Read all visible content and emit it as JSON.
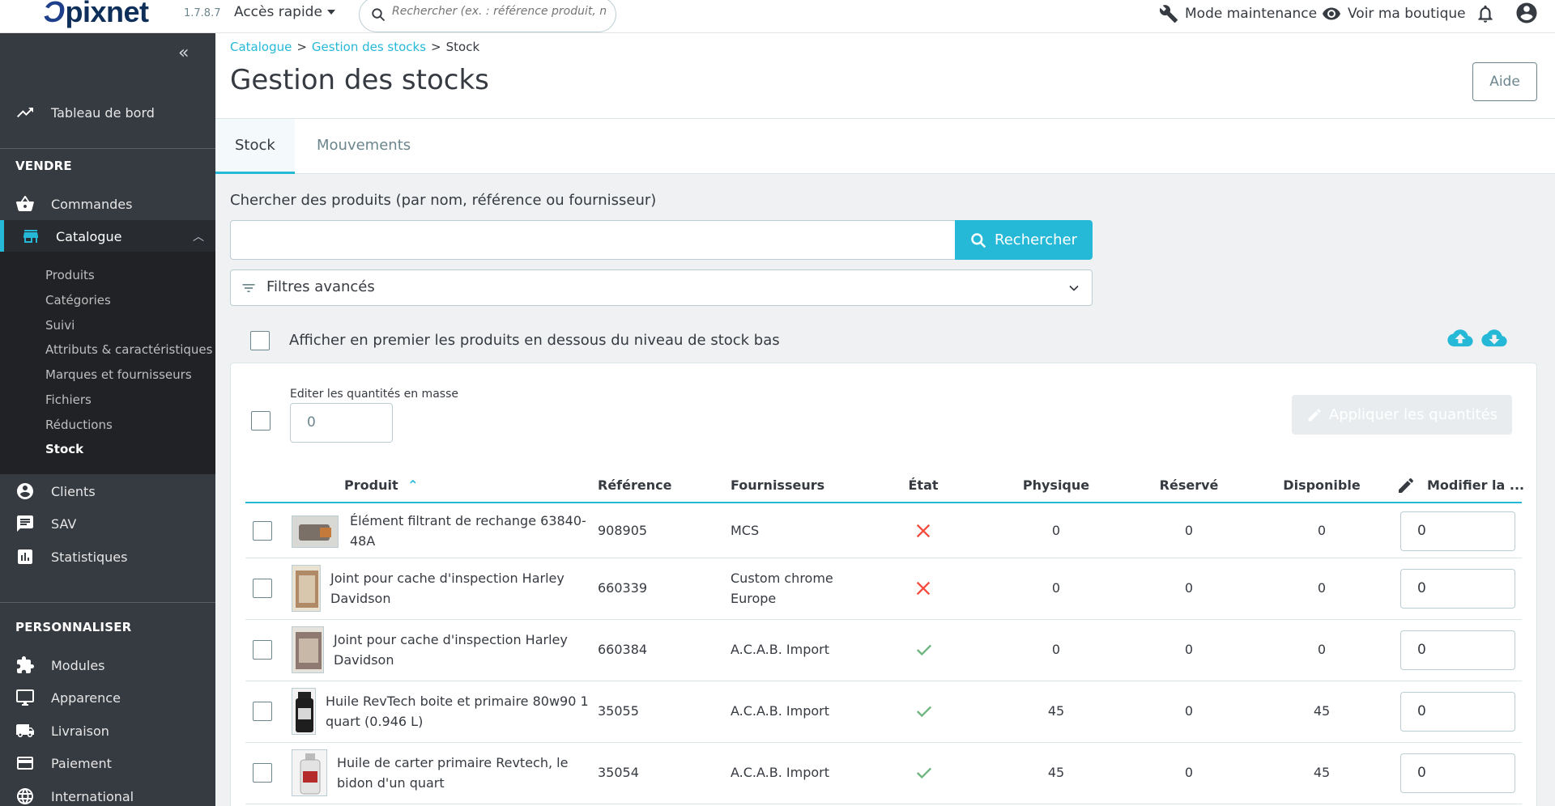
{
  "header": {
    "logo": "pixnet",
    "version": "1.7.8.7",
    "quick_access": "Accès rapide",
    "search_placeholder": "Rechercher (ex. : référence produit, no",
    "maintenance": "Mode maintenance",
    "view_shop": "Voir ma boutique"
  },
  "sidebar": {
    "dashboard": "Tableau de bord",
    "section_sell": "VENDRE",
    "orders": "Commandes",
    "catalog": "Catalogue",
    "catalog_items": [
      "Produits",
      "Catégories",
      "Suivi",
      "Attributs & caractéristiques",
      "Marques et fournisseurs",
      "Fichiers",
      "Réductions",
      "Stock"
    ],
    "customers": "Clients",
    "support": "SAV",
    "stats": "Statistiques",
    "section_customize": "PERSONNALISER",
    "modules": "Modules",
    "design": "Apparence",
    "shipping": "Livraison",
    "payment": "Paiement",
    "international": "International"
  },
  "breadcrumb": [
    "Catalogue",
    "Gestion des stocks",
    "Stock"
  ],
  "page_title": "Gestion des stocks",
  "help": "Aide",
  "tabs": [
    "Stock",
    "Mouvements"
  ],
  "search": {
    "label": "Chercher des produits (par nom, référence ou fournisseur)",
    "value": "",
    "button": "Rechercher",
    "filters": "Filtres avancés"
  },
  "low_stock_label": "Afficher en premier les produits en dessous du niveau de stock bas",
  "bulk": {
    "label": "Editer les quantités en masse",
    "value": "0",
    "apply": "Appliquer les quantités"
  },
  "table": {
    "headers": {
      "product": "Produit",
      "reference": "Référence",
      "suppliers": "Fournisseurs",
      "status": "État",
      "physical": "Physique",
      "reserved": "Réservé",
      "available": "Disponible",
      "edit": "Modifier la ..."
    },
    "rows": [
      {
        "name": "Élément filtrant de rechange 63840-48A",
        "reference": "908905",
        "supplier": "MCS",
        "status": "inactive",
        "physical": "0",
        "reserved": "0",
        "available": "0",
        "qty": "0"
      },
      {
        "name": "Joint pour cache d'inspection Harley Davidson",
        "reference": "660339",
        "supplier": "Custom chrome Europe",
        "status": "inactive",
        "physical": "0",
        "reserved": "0",
        "available": "0",
        "qty": "0"
      },
      {
        "name": "Joint pour cache d'inspection Harley Davidson",
        "reference": "660384",
        "supplier": "A.C.A.B. Import",
        "status": "active",
        "physical": "0",
        "reserved": "0",
        "available": "0",
        "qty": "0"
      },
      {
        "name": "Huile RevTech boite et primaire 80w90 1 quart (0.946 L)",
        "reference": "35055",
        "supplier": "A.C.A.B. Import",
        "status": "active",
        "physical": "45",
        "reserved": "0",
        "available": "45",
        "qty": "0"
      },
      {
        "name": "Huile de carter primaire Revtech, le bidon d'un quart",
        "reference": "35054",
        "supplier": "A.C.A.B. Import",
        "status": "active",
        "physical": "45",
        "reserved": "0",
        "available": "45",
        "qty": "0"
      }
    ]
  },
  "colors": {
    "accent": "#25b9d7",
    "sidebar": "#363a41",
    "danger": "#f54c3e",
    "success": "#70b580"
  }
}
